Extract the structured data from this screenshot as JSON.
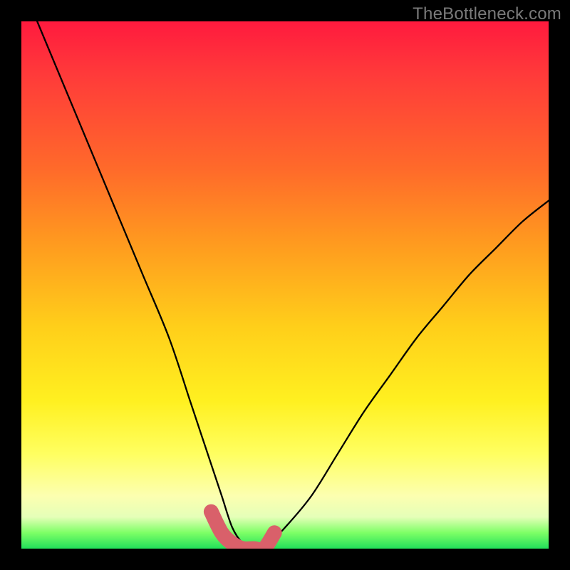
{
  "watermark": "TheBottleneck.com",
  "chart_data": {
    "type": "line",
    "title": "",
    "xlabel": "",
    "ylabel": "",
    "xlim": [
      0,
      100
    ],
    "ylim": [
      0,
      100
    ],
    "grid": false,
    "legend": false,
    "series": [
      {
        "name": "bottleneck-curve",
        "color": "#000000",
        "x": [
          3,
          8,
          13,
          18,
          23,
          28,
          32,
          34,
          36,
          38,
          40,
          42,
          44,
          46,
          50,
          55,
          60,
          65,
          70,
          75,
          80,
          85,
          90,
          95,
          100
        ],
        "values": [
          100,
          88,
          76,
          64,
          52,
          40,
          28,
          22,
          16,
          10,
          4,
          1,
          0,
          0,
          4,
          10,
          18,
          26,
          33,
          40,
          46,
          52,
          57,
          62,
          66
        ]
      },
      {
        "name": "optimal-zone-highlight",
        "color": "#d9606a",
        "x": [
          36,
          38,
          40,
          42,
          44,
          46,
          48
        ],
        "values": [
          7,
          3,
          1,
          0,
          0,
          0,
          3
        ]
      }
    ],
    "gradient_stops": [
      {
        "pos": 0,
        "color": "#ff1a3e"
      },
      {
        "pos": 10,
        "color": "#ff3a3a"
      },
      {
        "pos": 28,
        "color": "#ff6a2a"
      },
      {
        "pos": 42,
        "color": "#ff9a1f"
      },
      {
        "pos": 58,
        "color": "#ffcf1a"
      },
      {
        "pos": 72,
        "color": "#fff020"
      },
      {
        "pos": 82,
        "color": "#ffff60"
      },
      {
        "pos": 90,
        "color": "#fcffb0"
      },
      {
        "pos": 94,
        "color": "#e5ffb8"
      },
      {
        "pos": 97,
        "color": "#7dff66"
      },
      {
        "pos": 100,
        "color": "#22e05a"
      }
    ]
  }
}
